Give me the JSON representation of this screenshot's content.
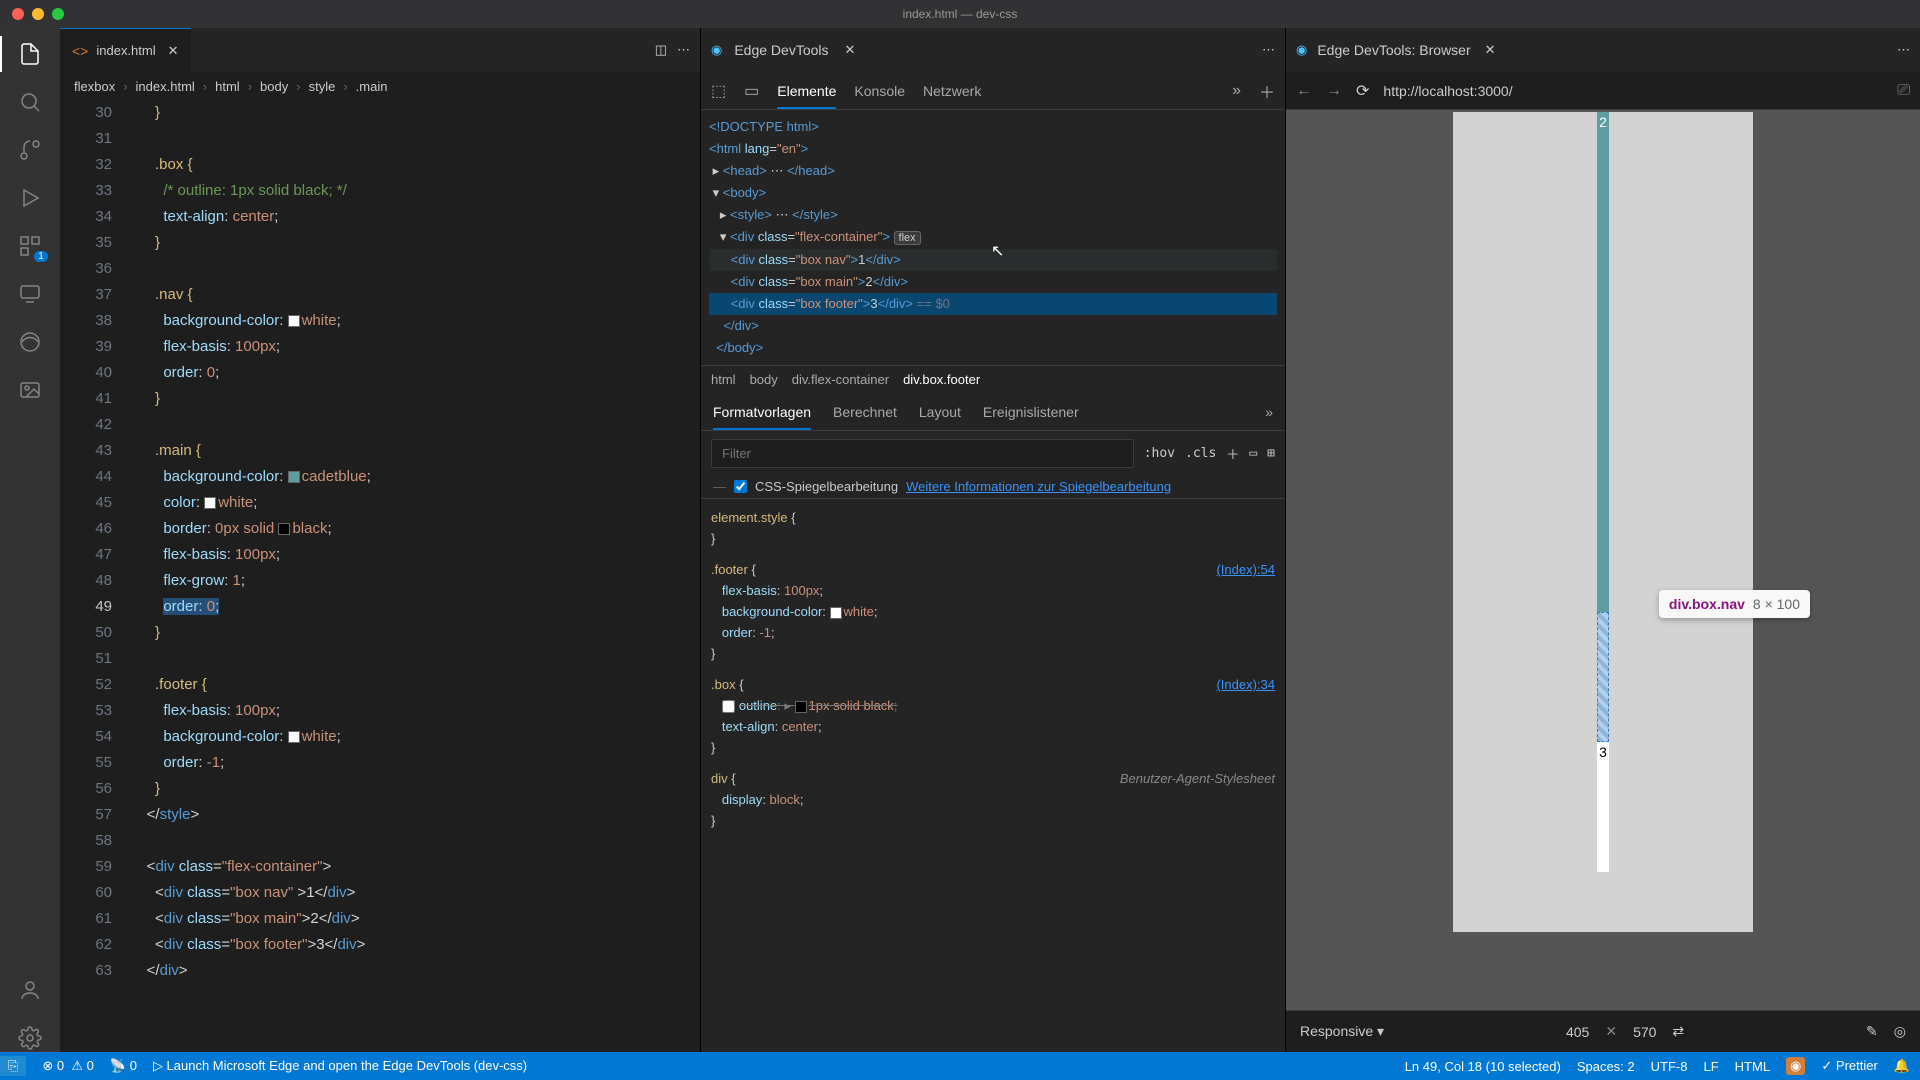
{
  "window_title": "index.html — dev-css",
  "editor_tab": {
    "name": "index.html"
  },
  "breadcrumbs": [
    "flexbox",
    "index.html",
    "html",
    "body",
    "style",
    ".main"
  ],
  "code_lines": [
    {
      "n": 30,
      "html": "      <span class='y'>}</span>"
    },
    {
      "n": 31,
      "html": ""
    },
    {
      "n": 32,
      "html": "      <span class='y'>.box</span> <span class='y'>{</span>"
    },
    {
      "n": 33,
      "html": "        <span class='g'>/* outline: 1px solid black; */</span>"
    },
    {
      "n": 34,
      "html": "        <span class='lb'>text-align</span>: <span class='o'>center</span>;"
    },
    {
      "n": 35,
      "html": "      <span class='y'>}</span>"
    },
    {
      "n": 36,
      "html": ""
    },
    {
      "n": 37,
      "html": "      <span class='y'>.nav</span> <span class='y'>{</span>"
    },
    {
      "n": 38,
      "html": "        <span class='lb'>background-color</span>: <span class='swatch' style='background:#fff'></span><span class='o'>white</span>;"
    },
    {
      "n": 39,
      "html": "        <span class='lb'>flex-basis</span>: <span class='o'>100px</span>;"
    },
    {
      "n": 40,
      "html": "        <span class='lb'>order</span>: <span class='o'>0</span>;"
    },
    {
      "n": 41,
      "html": "      <span class='y'>}</span>"
    },
    {
      "n": 42,
      "html": ""
    },
    {
      "n": 43,
      "html": "      <span class='y'>.main</span> <span class='y'>{</span>"
    },
    {
      "n": 44,
      "html": "        <span class='lb'>background-color</span>: <span class='swatch' style='background:#5f9ea0'></span><span class='o'>cadetblue</span>;"
    },
    {
      "n": 45,
      "html": "        <span class='lb'>color</span>: <span class='swatch' style='background:#fff'></span><span class='o'>white</span>;"
    },
    {
      "n": 46,
      "html": "        <span class='lb'>border</span>: <span class='o'>0px</span> <span class='o'>solid</span> <span class='swatch' style='background:#000'></span><span class='o'>black</span>;"
    },
    {
      "n": 47,
      "html": "        <span class='lb'>flex-basis</span>: <span class='o'>100px</span>;"
    },
    {
      "n": 48,
      "html": "        <span class='lb'>flex-grow</span>: <span class='o'>1</span>;"
    },
    {
      "n": 49,
      "hl": true,
      "html": "        <span class='sel'><span class='lb'>order</span>: <span class='o'>0</span>;</span>"
    },
    {
      "n": 50,
      "html": "      <span class='y'>}</span>"
    },
    {
      "n": 51,
      "html": ""
    },
    {
      "n": 52,
      "html": "      <span class='y'>.footer</span> <span class='y'>{</span>"
    },
    {
      "n": 53,
      "html": "        <span class='lb'>flex-basis</span>: <span class='o'>100px</span>;"
    },
    {
      "n": 54,
      "html": "        <span class='lb'>background-color</span>: <span class='swatch' style='background:#fff'></span><span class='o'>white</span>;"
    },
    {
      "n": 55,
      "html": "        <span class='lb'>order</span>: <span class='o'>-1</span>;"
    },
    {
      "n": 56,
      "html": "      <span class='y'>}</span>"
    },
    {
      "n": 57,
      "html": "    &lt;/<span class='b'>style</span>&gt;"
    },
    {
      "n": 58,
      "html": ""
    },
    {
      "n": 59,
      "html": "    &lt;<span class='b'>div</span> <span class='lb'>class</span>=<span class='o'>\"flex-container\"</span>&gt;"
    },
    {
      "n": 60,
      "html": "      &lt;<span class='b'>div</span> <span class='lb'>class</span>=<span class='o'>\"box nav\"</span> &gt;1&lt;/<span class='b'>div</span>&gt;"
    },
    {
      "n": 61,
      "html": "      &lt;<span class='b'>div</span> <span class='lb'>class</span>=<span class='o'>\"box main\"</span>&gt;2&lt;/<span class='b'>div</span>&gt;"
    },
    {
      "n": 62,
      "html": "      &lt;<span class='b'>div</span> <span class='lb'>class</span>=<span class='o'>\"box footer\"</span>&gt;3&lt;/<span class='b'>div</span>&gt;"
    },
    {
      "n": 63,
      "html": "    &lt;/<span class='b'>div</span>&gt;"
    }
  ],
  "devtools": {
    "tab_title": "Edge DevTools",
    "toolbar_tabs": [
      "Elemente",
      "Konsole",
      "Netzwerk"
    ],
    "toolbar_active": 0,
    "bc_path": [
      "html",
      "body",
      "div.flex-container",
      "div.box.footer"
    ],
    "styles_tabs": [
      "Formatvorlagen",
      "Berechnet",
      "Layout",
      "Ereignislistener"
    ],
    "styles_active": 0,
    "filter_placeholder": "Filter",
    "hov": ":hov",
    "cls": ".cls",
    "mirror_label": "CSS-Spiegelbearbeitung",
    "mirror_link": "Weitere Informationen zur Spiegelbearbeitung",
    "styles_rules": [
      {
        "sel": "element.style",
        "src": "",
        "props": []
      },
      {
        "sel": ".footer",
        "src": "(Index):54",
        "props": [
          {
            "k": "flex-basis",
            "v": "100px"
          },
          {
            "k": "background-color",
            "v": "white",
            "sw": "#fff"
          },
          {
            "k": "order",
            "v": "-1"
          }
        ]
      },
      {
        "sel": ".box",
        "src": "(Index):34",
        "props": [
          {
            "k": "outline",
            "v": "1px solid black",
            "strike": true,
            "sw": "#000",
            "cb": true
          },
          {
            "k": "text-align",
            "v": "center"
          }
        ]
      },
      {
        "sel": "div",
        "src": "Benutzer-Agent-Stylesheet",
        "ua": true,
        "props": [
          {
            "k": "display",
            "v": "block"
          }
        ]
      }
    ]
  },
  "browser": {
    "tab_title": "Edge DevTools: Browser",
    "url": "http://localhost:3000/",
    "tooltip_sel": "div.box.nav",
    "tooltip_dim": "8 × 100",
    "box2": "2",
    "box3": "3",
    "responsive": "Responsive",
    "vw": "405",
    "vh": "570"
  },
  "status": {
    "remote": "⎋",
    "errors": "0",
    "warnings": "0",
    "ports": "0",
    "launch": "Launch Microsoft Edge and open the Edge DevTools (dev-css)",
    "cursor": "Ln 49, Col 18 (10 selected)",
    "spaces": "Spaces: 2",
    "enc": "UTF-8",
    "eol": "LF",
    "lang": "HTML",
    "prettier": "Prettier"
  }
}
